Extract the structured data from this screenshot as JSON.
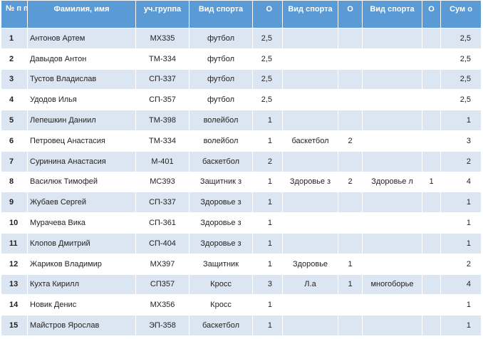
{
  "header": {
    "num": "№ п п",
    "name": "Фамилия,  имя",
    "group": "уч.группа",
    "sport1": "Вид спорта",
    "o1": "О",
    "sport2": "Вид спорта",
    "o2": "О",
    "sport3": "Вид спорта",
    "o3": "О",
    "sum": "Сум о"
  },
  "rows": [
    {
      "n": "1",
      "name": "Антонов Артем",
      "group": "МХ335",
      "s1": "футбол",
      "o1": "2,5",
      "s2": "",
      "o2": "",
      "s3": "",
      "o3": "",
      "sum": "2,5"
    },
    {
      "n": "2",
      "name": "Давыдов Антон",
      "group": "ТМ-334",
      "s1": "футбол",
      "o1": "2,5",
      "s2": "",
      "o2": "",
      "s3": "",
      "o3": "",
      "sum": "2,5"
    },
    {
      "n": "3",
      "name": "Тустов Владислав",
      "group": "СП-337",
      "s1": "футбол",
      "o1": "2,5",
      "s2": "",
      "o2": "",
      "s3": "",
      "o3": "",
      "sum": "2,5"
    },
    {
      "n": "4",
      "name": "Удодов Илья",
      "group": "СП-357",
      "s1": "футбол",
      "o1": "2,5",
      "s2": "",
      "o2": "",
      "s3": "",
      "o3": "",
      "sum": "2,5"
    },
    {
      "n": "5",
      "name": "Лепешкин  Даниил",
      "group": "ТМ-398",
      "s1": "волейбол",
      "o1": "1",
      "s2": "",
      "o2": "",
      "s3": "",
      "o3": "",
      "sum": "1"
    },
    {
      "n": "6",
      "name": "Петровец Анастасия",
      "group": "ТМ-334",
      "s1": "волейбол",
      "o1": "1",
      "s2": "баскетбол",
      "o2": "2",
      "s3": "",
      "o3": "",
      "sum": "3"
    },
    {
      "n": "7",
      "name": "Суринина Анастасия",
      "group": "М-401",
      "s1": "баскетбол",
      "o1": "2",
      "s2": "",
      "o2": "",
      "s3": "",
      "o3": "",
      "sum": "2"
    },
    {
      "n": "8",
      "name": "Василюк Тимофей",
      "group": "МС393",
      "s1": "Защитник з",
      "o1": "1",
      "s2": "Здоровье з",
      "o2": "2",
      "s3": "Здоровье  л",
      "o3": "1",
      "sum": "4"
    },
    {
      "n": "9",
      "name": "Жубаев Сергей",
      "group": "СП-337",
      "s1": "Здоровье з",
      "o1": "1",
      "s2": "",
      "o2": "",
      "s3": "",
      "o3": "",
      "sum": "1"
    },
    {
      "n": "10",
      "name": "Мурачева Вика",
      "group": "СП-361",
      "s1": "Здоровье з",
      "o1": "1",
      "s2": "",
      "o2": "",
      "s3": "",
      "o3": "",
      "sum": "1"
    },
    {
      "n": "11",
      "name": "Клопов Дмитрий",
      "group": "СП-404",
      "s1": "Здоровье з",
      "o1": "1",
      "s2": "",
      "o2": "",
      "s3": "",
      "o3": "",
      "sum": "1"
    },
    {
      "n": "12",
      "name": "Жариков Владимир",
      "group": "МХ397",
      "s1": "Защитник",
      "o1": "1",
      "s2": "Здоровье",
      "o2": "1",
      "s3": "",
      "o3": "",
      "sum": "2"
    },
    {
      "n": "13",
      "name": "Кухта Кирилл",
      "group": "СП357",
      "s1": "Кросс",
      "o1": "3",
      "s2": "Л.а",
      "o2": "1",
      "s3": "многоборье",
      "o3": "",
      "sum": "4"
    },
    {
      "n": "14",
      "name": "Новик Денис",
      "group": "МХ356",
      "s1": "Кросс",
      "o1": "1",
      "s2": "",
      "o2": "",
      "s3": "",
      "o3": "",
      "sum": "1"
    },
    {
      "n": "15",
      "name": "Майстров Ярослав",
      "group": "ЭП-358",
      "s1": "баскетбол",
      "o1": "1",
      "s2": "",
      "o2": "",
      "s3": "",
      "o3": "",
      "sum": "1"
    }
  ],
  "colors": {
    "header_bg": "#5b9bd5",
    "band_bg": "#dce6f2"
  }
}
